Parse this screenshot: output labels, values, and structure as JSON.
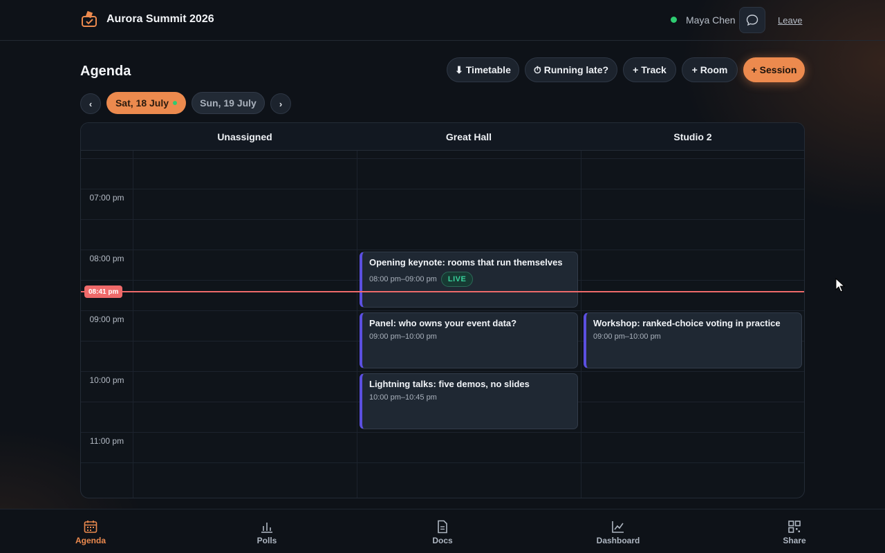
{
  "app": {
    "title": "Aurora Summit 2026"
  },
  "user": {
    "name": "Maya Chen",
    "status_color": "#2ecc71",
    "leave_label": "Leave"
  },
  "page": {
    "title": "Agenda"
  },
  "actions": {
    "timetable": "⬇ Timetable",
    "running_late": "⏱ Running late?",
    "add_track": "+ Track",
    "add_room": "+ Room",
    "add_session": "+ Session"
  },
  "days": [
    {
      "label": "Sat, 18 July",
      "active": true
    },
    {
      "label": "Sun, 19 July",
      "active": false
    }
  ],
  "day_nav": {
    "prev": "‹",
    "next": "›"
  },
  "columns": [
    "Unassigned",
    "Great Hall",
    "Studio 2"
  ],
  "times": [
    "07:00 pm",
    "08:00 pm",
    "09:00 pm",
    "10:00 pm",
    "11:00 pm"
  ],
  "now": {
    "label": "08:41 pm",
    "color": "#ef6a6a"
  },
  "sessions": [
    {
      "title": "Opening keynote: rooms that run themselves",
      "time": "08:00 pm–09:00 pm",
      "room": "Great Hall",
      "live": "LIVE"
    },
    {
      "title": "Panel: who owns your event data?",
      "time": "09:00 pm–10:00 pm",
      "room": "Great Hall"
    },
    {
      "title": "Lightning talks: five demos, no slides",
      "time": "10:00 pm–10:45 pm",
      "room": "Great Hall"
    },
    {
      "title": "Workshop: ranked-choice voting in practice",
      "time": "09:00 pm–10:00 pm",
      "room": "Studio 2"
    }
  ],
  "bottom_nav": [
    {
      "label": "Agenda",
      "icon": "calendar-icon",
      "active": true
    },
    {
      "label": "Polls",
      "icon": "bar-chart-icon"
    },
    {
      "label": "Docs",
      "icon": "document-icon"
    },
    {
      "label": "Dashboard",
      "icon": "line-chart-icon"
    },
    {
      "label": "Share",
      "icon": "qr-code-icon"
    }
  ],
  "colors": {
    "accent": "#ec8a4e",
    "event_border": "#5b4fe0",
    "live_green": "#37d19b"
  }
}
